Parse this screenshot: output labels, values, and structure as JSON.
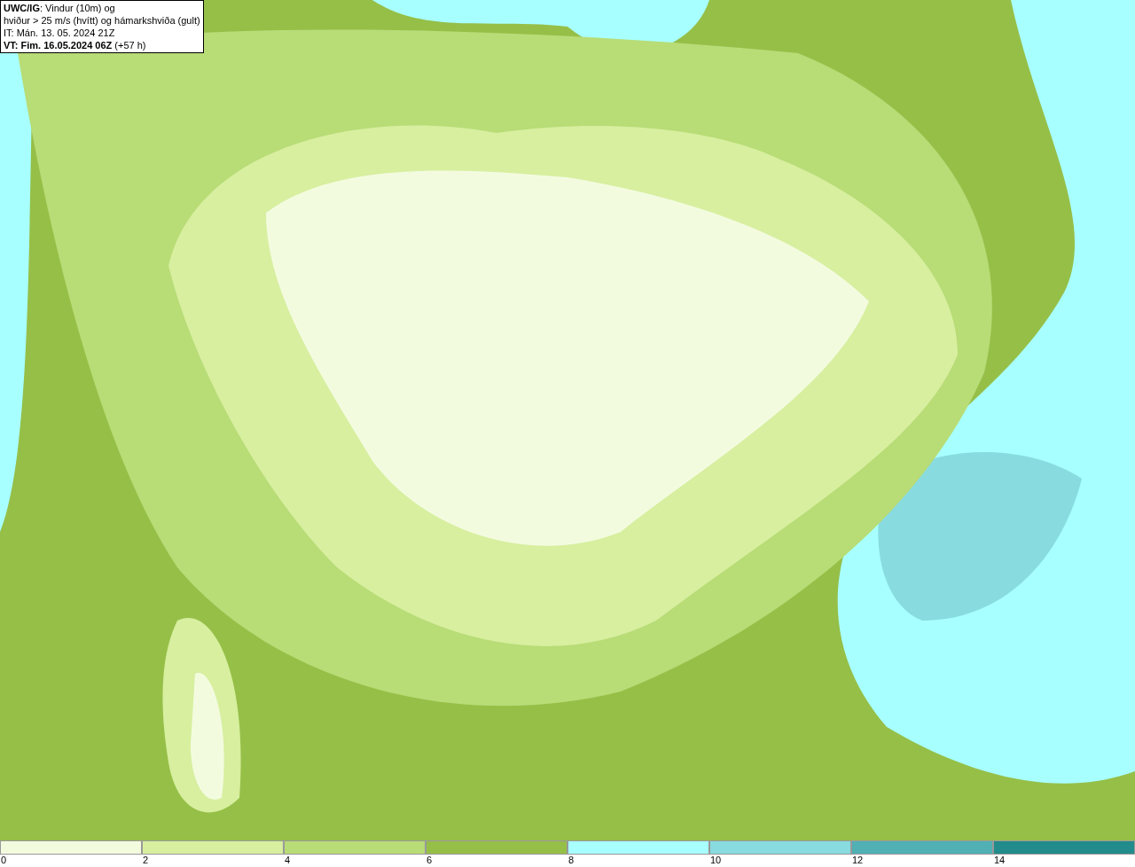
{
  "title_box": {
    "lines": [
      "**UWC/IG**: Vindur (10m) og",
      "hviður > 25 m/s (hvítt) og hámarkshviða (gult)",
      "IT: Mán. 13. 05. 2024 21Z",
      "**VT: Fim. 16.05.2024 06Z** (+57 h)"
    ]
  },
  "legend": {
    "bins": [
      {
        "label": "0",
        "color": "#f3fbdf"
      },
      {
        "label": "2",
        "color": "#d7ef9f"
      },
      {
        "label": "4",
        "color": "#b8dc76"
      },
      {
        "label": "6",
        "color": "#96bf48"
      },
      {
        "label": "8",
        "color": "#a8ffff"
      },
      {
        "label": "10",
        "color": "#88dbdf"
      },
      {
        "label": "12",
        "color": "#50b0b4"
      },
      {
        "label": "14",
        "color": "#228b8b"
      }
    ]
  }
}
